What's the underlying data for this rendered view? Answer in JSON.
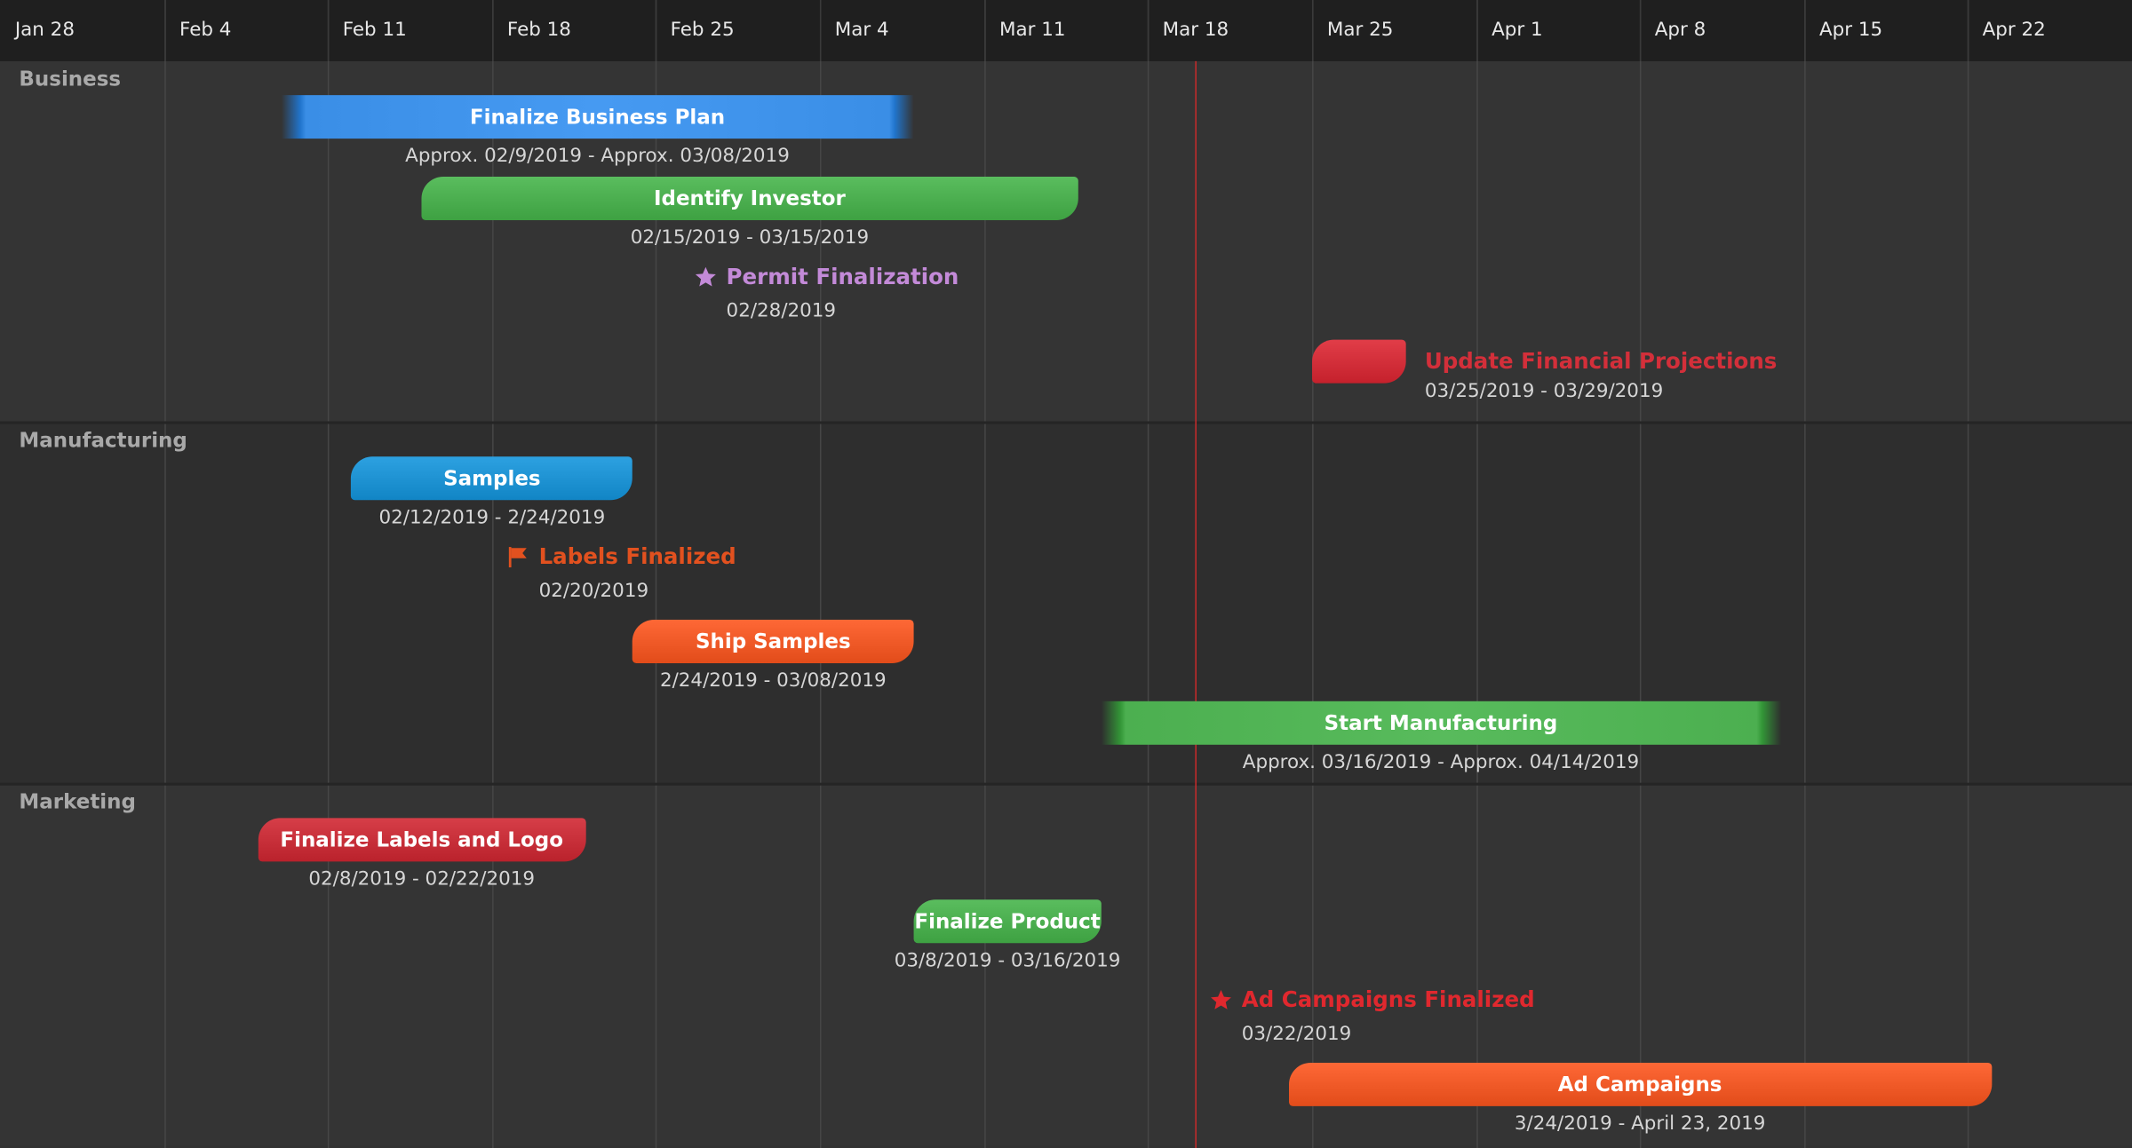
{
  "chart_data": {
    "type": "gantt",
    "timeline": {
      "start": "2019-01-28",
      "end": "2019-04-29",
      "week_labels": [
        "Jan 28",
        "Feb 4",
        "Feb 11",
        "Feb 18",
        "Feb 25",
        "Mar 4",
        "Mar 11",
        "Mar 18",
        "Mar 25",
        "Apr 1",
        "Apr 8",
        "Apr 15",
        "Apr 22"
      ],
      "today": "2019-03-20"
    },
    "lanes": [
      {
        "name": "Business",
        "items": [
          {
            "kind": "task",
            "title": "Finalize Business Plan",
            "start": "2019-02-09",
            "end": "2019-03-08",
            "date_label": "Approx. 02/9/2019 - Approx. 03/08/2019",
            "color": "#3a8ee6",
            "approx": true
          },
          {
            "kind": "task",
            "title": "Identify Investor",
            "start": "2019-02-15",
            "end": "2019-03-15",
            "date_label": "02/15/2019 - 03/15/2019",
            "color": "#4caf50",
            "approx": false
          },
          {
            "kind": "milestone",
            "title": "Permit Finalization",
            "date": "2019-02-28",
            "date_label": "02/28/2019",
            "color": "#c38ad8",
            "icon": "star"
          },
          {
            "kind": "task",
            "title": "Update Financial Projections",
            "start": "2019-03-25",
            "end": "2019-03-29",
            "date_label": "03/25/2019 - 03/29/2019",
            "color": "#d32f3a",
            "approx": false,
            "label_outside": true
          }
        ]
      },
      {
        "name": "Manufacturing",
        "items": [
          {
            "kind": "task",
            "title": "Samples",
            "start": "2019-02-12",
            "end": "2019-02-24",
            "date_label": "02/12/2019 - 2/24/2019",
            "color": "#1f93d3",
            "approx": false
          },
          {
            "kind": "milestone",
            "title": "Labels Finalized",
            "date": "2019-02-20",
            "date_label": "02/20/2019",
            "color": "#e2511f",
            "icon": "flag"
          },
          {
            "kind": "task",
            "title": "Ship Samples",
            "start": "2019-02-24",
            "end": "2019-03-08",
            "date_label": "2/24/2019 - 03/08/2019",
            "color": "#f05a28",
            "approx": false
          },
          {
            "kind": "task",
            "title": "Start Manufacturing",
            "start": "2019-03-16",
            "end": "2019-04-14",
            "date_label": "Approx. 03/16/2019 - Approx. 04/14/2019",
            "color": "#4caf50",
            "approx": true
          }
        ]
      },
      {
        "name": "Marketing",
        "items": [
          {
            "kind": "task",
            "title": "Finalize Labels and Logo",
            "start": "2019-02-08",
            "end": "2019-02-22",
            "date_label": "02/8/2019 - 02/22/2019",
            "color": "#c8303a",
            "approx": false
          },
          {
            "kind": "task",
            "title": "Finalize Product",
            "start": "2019-03-08",
            "end": "2019-03-16",
            "date_label": "03/8/2019 - 03/16/2019",
            "color": "#4caf50",
            "approx": false
          },
          {
            "kind": "milestone",
            "title": "Ad Campaigns Finalized",
            "date": "2019-03-22",
            "date_label": "03/22/2019",
            "color": "#e0282e",
            "icon": "star"
          },
          {
            "kind": "task",
            "title": "Ad Campaigns",
            "start": "2019-03-24",
            "end": "2019-04-23",
            "date_label": "3/24/2019 - April 23, 2019",
            "color": "#f05a28",
            "approx": false
          }
        ]
      }
    ]
  }
}
